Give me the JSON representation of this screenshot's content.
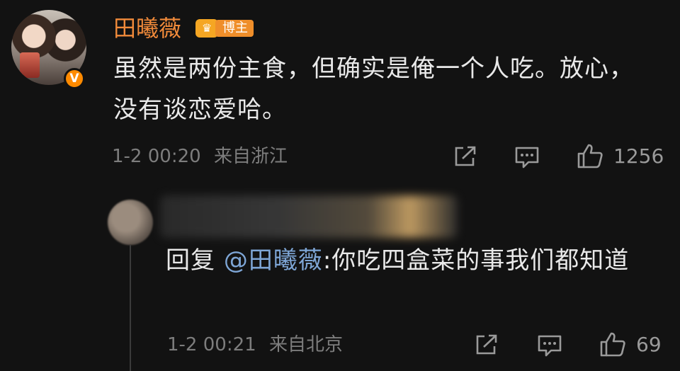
{
  "comment": {
    "username": "田曦薇",
    "badge_label": "博主",
    "badge_icon": "blogger-crown-icon",
    "verified_mark": "V",
    "text": "虽然是两份主食，但确实是俺一个人吃。放心，没有谈恋爱哈。",
    "time": "1-2 00:20",
    "location": "来自浙江",
    "likes": "1256"
  },
  "reply": {
    "prefix": "回复 ",
    "mention": "@田曦薇",
    "text": ":你吃四盒菜的事我们都知道",
    "time": "1-2 00:21",
    "location": "来自北京",
    "likes": "69"
  },
  "colors": {
    "background": "#121212",
    "username": "#f08a3a",
    "mention": "#7ea6d6",
    "meta": "#7d7d7d",
    "badge": "#ef8e2a",
    "verified": "#ff8a00"
  }
}
